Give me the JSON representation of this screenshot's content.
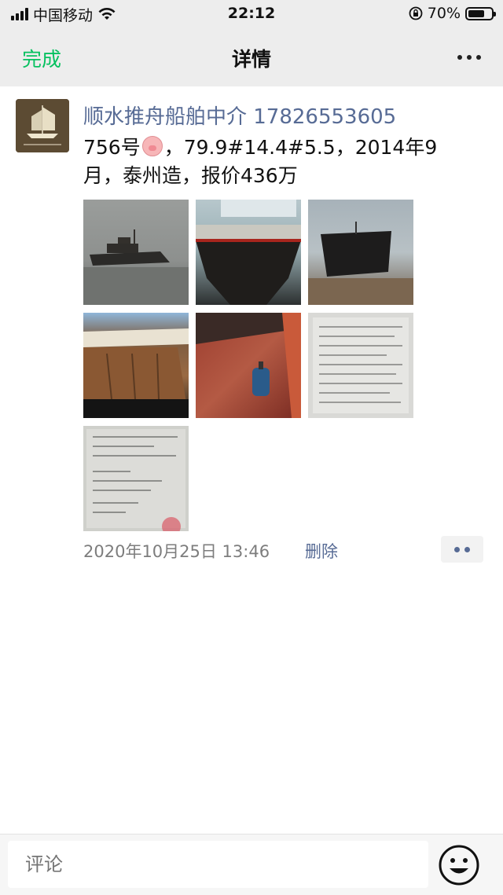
{
  "status_bar": {
    "carrier": "中国移动",
    "time": "22:12",
    "battery": "70%",
    "battery_level": 0.7
  },
  "nav": {
    "done": "完成",
    "title": "详情"
  },
  "post": {
    "author": "顺水推舟船舶中介 17826553605",
    "text_before_emoji": "756号",
    "emoji": "pig-face-icon",
    "text_after_emoji": "，79.9#14.4#5.5，2014年9月，泰州造，报价436万",
    "time": "2020年10月25日 13:46",
    "delete": "删除",
    "photo_count": 7
  },
  "comment_bar": {
    "placeholder": "评论"
  },
  "colors": {
    "accent_green": "#07c160",
    "link_blue": "#576b95",
    "bar_bg": "#ededed"
  }
}
